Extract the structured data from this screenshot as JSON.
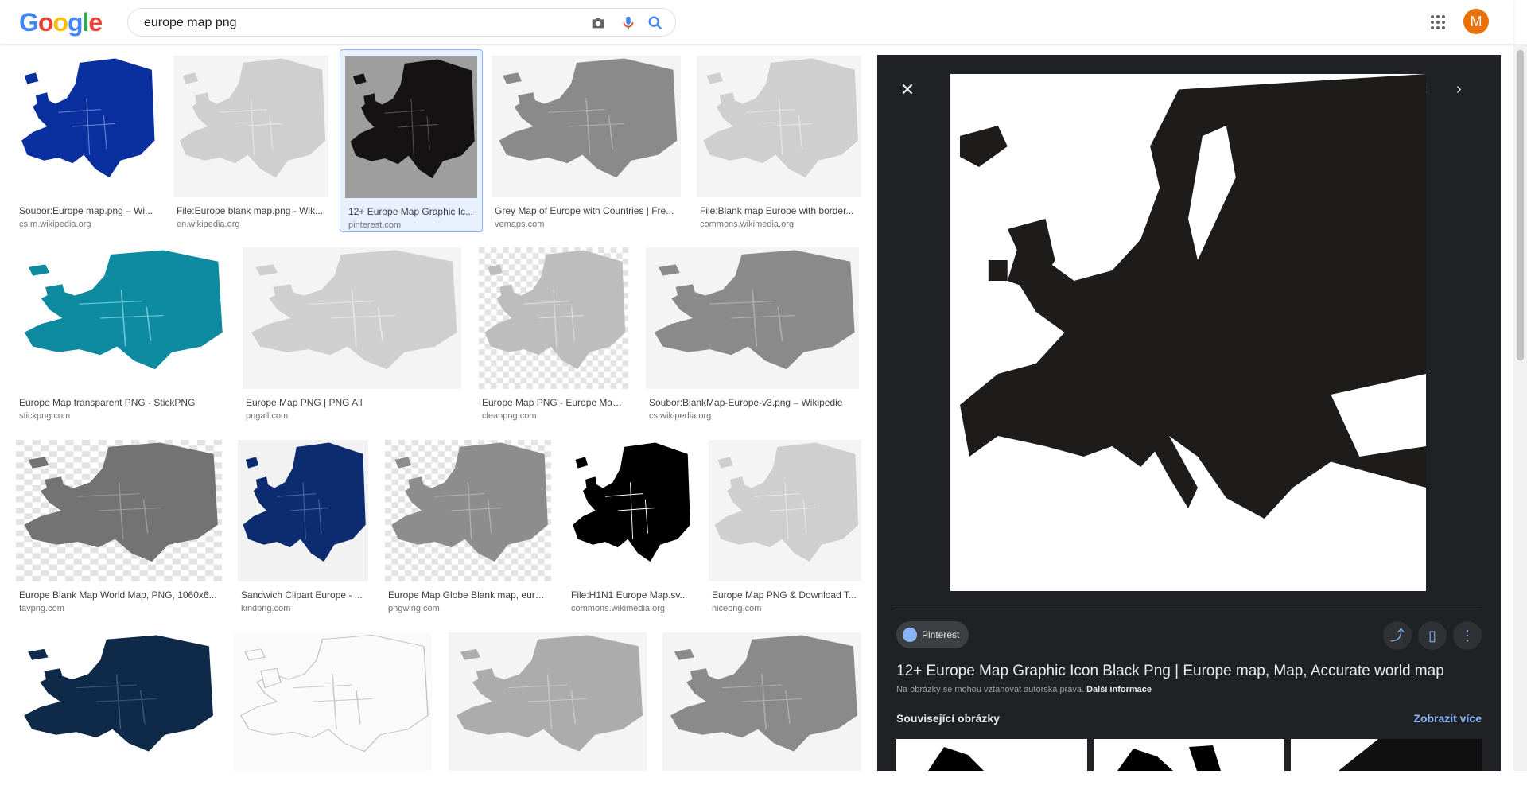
{
  "logo": {
    "letters": [
      "G",
      "o",
      "o",
      "g",
      "l",
      "e"
    ],
    "colors": [
      "#4285F4",
      "#EA4335",
      "#FBBC05",
      "#4285F4",
      "#34A853",
      "#EA4335"
    ]
  },
  "search": {
    "query": "europe map png"
  },
  "header": {
    "avatar_letter": "M"
  },
  "results": [
    {
      "title": "Soubor:Europe map.png – Wi...",
      "source": "cs.m.wikipedia.org",
      "style": "blue"
    },
    {
      "title": "File:Europe blank map.png - Wik...",
      "source": "en.wikipedia.org",
      "style": "light"
    },
    {
      "title": "12+ Europe Map Graphic Ic...",
      "source": "pinterest.com",
      "style": "black",
      "selected": true
    },
    {
      "title": "Grey Map of Europe with Countries | Fre...",
      "source": "vemaps.com",
      "style": "grey"
    },
    {
      "title": "File:Blank map Europe with border...",
      "source": "commons.wikimedia.org",
      "style": "light"
    },
    {
      "title": "Europe Map transparent PNG - StickPNG",
      "source": "stickpng.com",
      "style": "teal"
    },
    {
      "title": "Europe Map PNG | PNG All",
      "source": "pngall.com",
      "style": "light"
    },
    {
      "title": "Europe Map PNG - Europe Map ...",
      "source": "cleanpng.com",
      "style": "checker"
    },
    {
      "title": "Soubor:BlankMap-Europe-v3.png – Wikipedie",
      "source": "cs.wikipedia.org",
      "style": "grey"
    },
    {
      "title": "Europe Blank Map World Map, PNG, 1060x6...",
      "source": "favpng.com",
      "style": "greychecker"
    },
    {
      "title": "Sandwich Clipart Europe - ...",
      "source": "kindpng.com",
      "style": "navy"
    },
    {
      "title": "Europe Map Globe Blank map, euro...",
      "source": "pngwing.com",
      "style": "checkergrey"
    },
    {
      "title": "File:H1N1 Europe Map.sv...",
      "source": "commons.wikimedia.org",
      "style": "blackwhite"
    },
    {
      "title": "Europe Map PNG & Download T...",
      "source": "nicepng.com",
      "style": "light"
    },
    {
      "title": "",
      "source": "",
      "style": "darknavy"
    },
    {
      "title": "",
      "source": "",
      "style": "outline"
    },
    {
      "title": "",
      "source": "",
      "style": "lightgrey"
    },
    {
      "title": "",
      "source": "",
      "style": "grey"
    }
  ],
  "panel": {
    "source_chip": "Pinterest",
    "title": "12+ Europe Map Graphic Icon Black Png | Europe map, Map, Accurate world map",
    "copyright_note": "Na obrázky se mohou vztahovat autorská práva.",
    "more_info": "Další informace",
    "related_label": "Související obrázky",
    "show_more": "Zobrazit více"
  },
  "icons": {
    "camera": "camera-icon",
    "mic": "mic-icon",
    "search": "search-icon",
    "apps": "apps-grid-icon",
    "close": "close-icon",
    "share": "share-icon",
    "bookmark": "bookmark-icon",
    "more": "more-vert-icon"
  }
}
